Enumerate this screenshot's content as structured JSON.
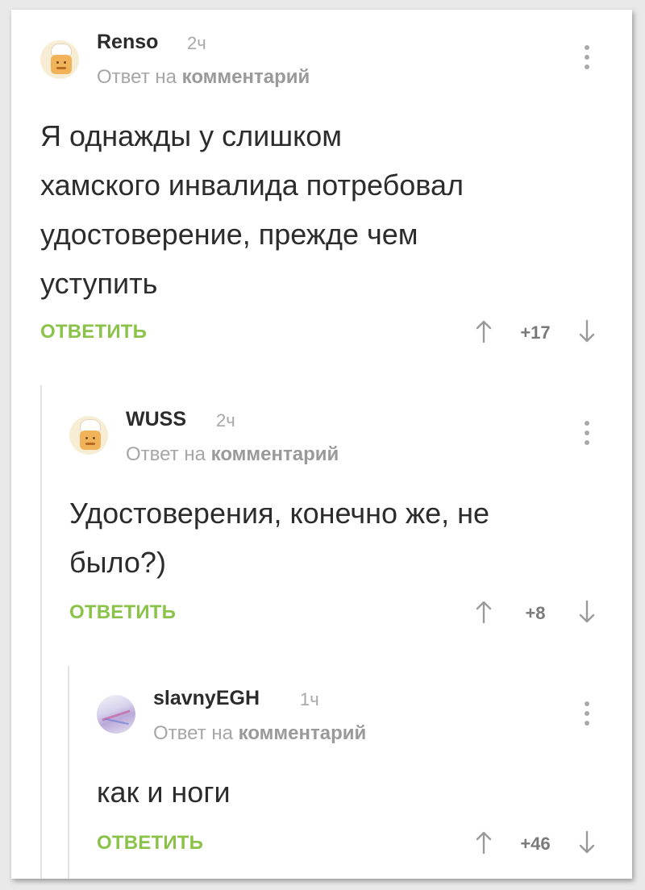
{
  "comments": [
    {
      "username": "Renso",
      "time": "2ч",
      "reply_prefix": "Ответ на",
      "reply_target": "комментарий",
      "text_lines": [
        "Я однажды у слишком",
        "хамского инвалида потребовал",
        "удостоверение, прежде чем",
        "уступить"
      ],
      "reply_label": "ОТВЕТИТЬ",
      "rating": "+17"
    },
    {
      "username": "WUSS",
      "time": "2ч",
      "reply_prefix": "Ответ на",
      "reply_target": "комментарий",
      "text_lines": [
        "Удостоверения, конечно же, не",
        "было?)"
      ],
      "reply_label": "ОТВЕТИТЬ",
      "rating": "+8"
    },
    {
      "username": "slavnyEGH",
      "time": "1ч",
      "reply_prefix": "Ответ на",
      "reply_target": "комментарий",
      "text_lines": [
        "как и ноги"
      ],
      "reply_label": "ОТВЕТИТЬ",
      "rating": "+46"
    }
  ],
  "colors": {
    "accent_green": "#8bc34a",
    "meta_gray": "#a6a6a6",
    "text": "#2c2c2c",
    "thread_line": "#e3e3e3"
  },
  "icons": {
    "menu": "vertical-dots-icon",
    "upvote": "arrow-up-icon",
    "downvote": "arrow-down-icon",
    "avatar_1": "cook-avatar",
    "avatar_2": "cook-avatar",
    "avatar_3": "abstract-avatar"
  }
}
